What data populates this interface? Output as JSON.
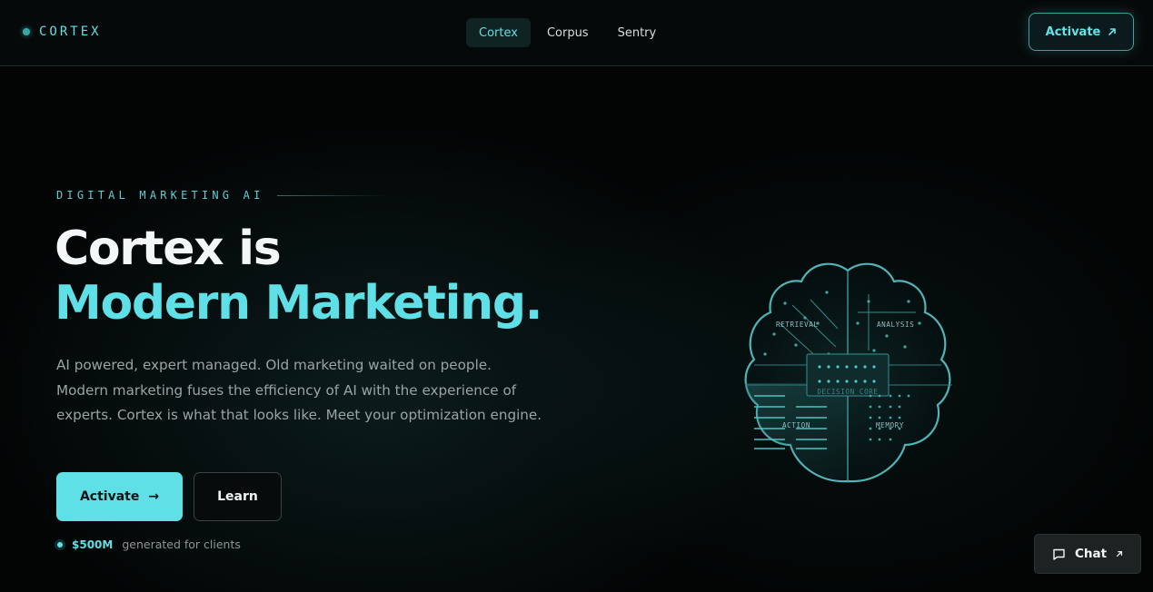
{
  "header": {
    "brand": "CORTEX",
    "nav": [
      {
        "label": "Cortex",
        "active": true
      },
      {
        "label": "Corpus",
        "active": false
      },
      {
        "label": "Sentry",
        "active": false
      }
    ],
    "cta_label": "Activate"
  },
  "hero": {
    "eyebrow": "DIGITAL MARKETING AI",
    "headline_line1": "Cortex is",
    "headline_line2": "Modern Marketing.",
    "lede": "AI powered, expert managed. Old marketing waited on people. Modern marketing fuses the efficiency of AI with the experience of experts. Cortex is what that looks like. Meet your optimization engine.",
    "primary_cta": "Activate",
    "primary_cta_arrow": "→",
    "secondary_cta": "Learn",
    "stat_value": "$500M",
    "stat_label": "generated for clients"
  },
  "brain": {
    "retrieval": "RETRIEVAL",
    "analysis": "ANALYSIS",
    "decision_core": "DECISION CORE",
    "action": "ACTION",
    "memory": "MEMORY"
  },
  "chat": {
    "label": "Chat"
  },
  "colors": {
    "accent": "#5ee0e6",
    "background": "#030505",
    "muted_text": "#9aa4a4"
  },
  "icons": {
    "brand": "status-dot-icon",
    "header_cta": "arrow-up-right-icon",
    "chat": "message-square-icon"
  }
}
